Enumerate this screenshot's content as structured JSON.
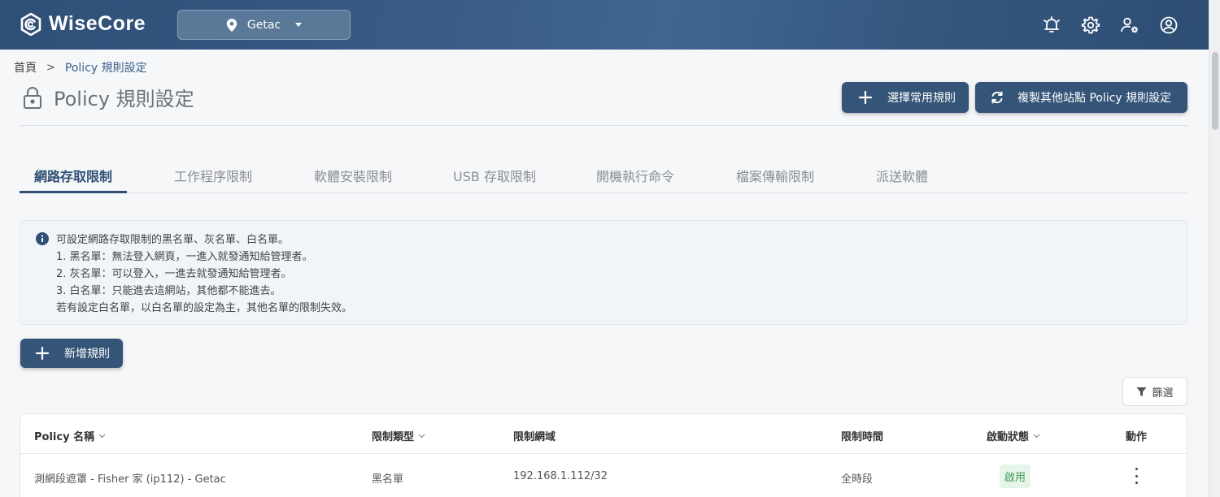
{
  "app": {
    "brand": "WiseCore",
    "site": "Getac"
  },
  "breadcrumb": {
    "home": "首頁",
    "separator": ">",
    "current": "Policy 規則設定"
  },
  "page": {
    "title": "Policy 規則設定",
    "btn_common": "選擇常用規則",
    "btn_copy": "複製其他站點 Policy 規則設定"
  },
  "tabs": [
    {
      "label": "網路存取限制",
      "active": true
    },
    {
      "label": "工作程序限制"
    },
    {
      "label": "軟體安裝限制"
    },
    {
      "label": "USB 存取限制"
    },
    {
      "label": "開機執行命令"
    },
    {
      "label": "檔案傳輸限制"
    },
    {
      "label": "派送軟體"
    }
  ],
  "info": {
    "lines": [
      "可設定網路存取限制的黑名單、灰名單、白名單。",
      "1. 黑名單：無法登入網頁，一進入就發通知給管理者。",
      "2. 灰名單：可以登入，一進去就發通知給管理者。",
      "3. 白名單：只能進去這網站，其他都不能進去。",
      "若有設定白名單，以白名單的設定為主，其他名單的限制失效。"
    ]
  },
  "actions": {
    "add_rule": "新增規則",
    "filter": "篩選"
  },
  "table": {
    "columns": {
      "name": "Policy 名稱",
      "type": "限制類型",
      "domain": "限制網域",
      "time": "限制時間",
      "status": "啟動狀態",
      "action": "動作"
    },
    "rows": [
      {
        "name": "測網段遮罩 - Fisher 家 (ip112) - Getac",
        "type": "黑名單",
        "domain": "192.168.1.112/32",
        "time": "全時段",
        "status": "啟用"
      }
    ]
  },
  "colors": {
    "header": "#345478",
    "accent": "#2f4f74",
    "status_enabled": "#3f9a55"
  }
}
